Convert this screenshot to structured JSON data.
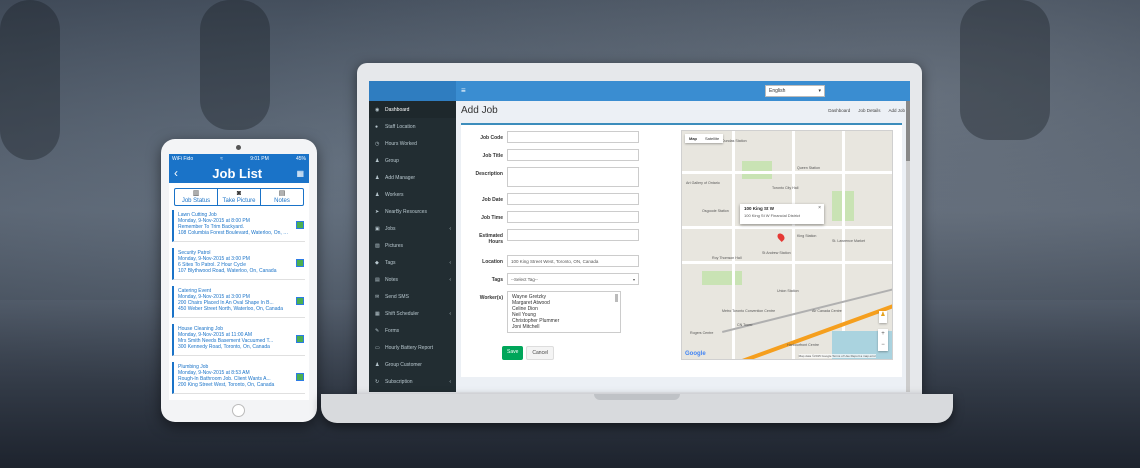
{
  "tablet": {
    "status": {
      "carrier": "WiFi Fido",
      "wifi": "≈",
      "time": "9:01 PM",
      "battery": "45%"
    },
    "title": "Job List",
    "segments": [
      {
        "label": "Job Status",
        "icon": "chart-icon"
      },
      {
        "label": "Take Picture",
        "icon": "camera-icon"
      },
      {
        "label": "Notes",
        "icon": "clipboard-icon"
      }
    ],
    "jobs": [
      {
        "title": "Lawn Cutting Job",
        "date": "Monday, 9-Nov-2015 at 8:00 PM",
        "note": "Remember To Trim Backyard.",
        "address": "108 Columbia Forest Boulevard, Waterloo, On, Canada"
      },
      {
        "title": "Security Patrol",
        "date": "Monday, 9-Nov-2015 at 3:00 PM",
        "note": "6 Sites To Patrol. 2 Hour Cycle",
        "address": "107 Blythwood Road, Waterloo, On, Canada"
      },
      {
        "title": "Catering Event",
        "date": "Monday, 9-Nov-2015 at 3:00 PM",
        "note": "200 Chairs Placed In An Oval Shape In B...",
        "address": "450 Weber Street North, Waterloo, On, Canada"
      },
      {
        "title": "House Cleaning Job",
        "date": "Monday, 9-Nov-2015 at 11:00 AM",
        "note": "Mrs Smith Needs Basement Vacuumed T...",
        "address": "300 Kennedy Road, Toronto, On, Canada"
      },
      {
        "title": "Plumbing Job",
        "date": "Monday, 9-Nov-2015 at 8:53 AM",
        "note": "Rough-In Bathroom Job. Client Wants A...",
        "address": "200 King Street West, Toronto, On, Canada"
      }
    ]
  },
  "app": {
    "menu_icon": "≡",
    "language": "English",
    "page_title": "Add Job",
    "breadcrumbs": [
      "Dashboard",
      "Job Details",
      "Add Job"
    ],
    "sidebar": [
      {
        "label": "Dashboard",
        "icon": "dashboard-icon",
        "glyph": "◉",
        "arrow": ""
      },
      {
        "label": "Staff Location",
        "icon": "location-icon",
        "glyph": "●",
        "arrow": ""
      },
      {
        "label": "Hours Worked",
        "icon": "clock-icon",
        "glyph": "◷",
        "arrow": ""
      },
      {
        "label": "Group",
        "icon": "group-icon",
        "glyph": "♟",
        "arrow": ""
      },
      {
        "label": "Add Manager",
        "icon": "user-plus-icon",
        "glyph": "♟",
        "arrow": ""
      },
      {
        "label": "Workers",
        "icon": "users-icon",
        "glyph": "♟",
        "arrow": ""
      },
      {
        "label": "NearBy Resources",
        "icon": "send-icon",
        "glyph": "➤",
        "arrow": ""
      },
      {
        "label": "Jobs",
        "icon": "briefcase-icon",
        "glyph": "▣",
        "arrow": "‹"
      },
      {
        "label": "Pictures",
        "icon": "picture-icon",
        "glyph": "▨",
        "arrow": ""
      },
      {
        "label": "Tags",
        "icon": "tag-icon",
        "glyph": "◆",
        "arrow": "‹"
      },
      {
        "label": "Notes",
        "icon": "notes-icon",
        "glyph": "▤",
        "arrow": "‹"
      },
      {
        "label": "Send SMS",
        "icon": "envelope-icon",
        "glyph": "✉",
        "arrow": ""
      },
      {
        "label": "Shift Scheduler",
        "icon": "calendar-icon",
        "glyph": "▦",
        "arrow": "‹"
      },
      {
        "label": "Forms",
        "icon": "forms-icon",
        "glyph": "✎",
        "arrow": ""
      },
      {
        "label": "Hourly Battery Report",
        "icon": "battery-icon",
        "glyph": "▭",
        "arrow": ""
      },
      {
        "label": "Group Customer",
        "icon": "customer-icon",
        "glyph": "♟",
        "arrow": ""
      },
      {
        "label": "Subscription",
        "icon": "subscription-icon",
        "glyph": "↻",
        "arrow": "‹"
      }
    ],
    "form": {
      "job_code_label": "Job Code",
      "job_code": "",
      "job_title_label": "Job Title",
      "job_title": "",
      "description_label": "Description",
      "description": "",
      "job_date_label": "Job Date",
      "job_date": "",
      "job_time_label": "Job Time",
      "job_time": "",
      "estimated_hours_label": "Estimated Hours",
      "estimated_hours": "",
      "location_label": "Location",
      "location": "100 King Street West, Toronto, ON, Canada",
      "tags_label": "Tags",
      "tags_placeholder": "--Select Tag--",
      "workers_label": "Worker(s)",
      "workers": [
        "Wayne Gretzky",
        "Margaret Atwood",
        "Celine Dion",
        "Neil Young",
        "Christopher Plummer",
        "Joni Mitchell"
      ],
      "save": "Save",
      "cancel": "Cancel"
    },
    "map": {
      "tab_map": "Map",
      "tab_satellite": "Satellite",
      "popup_title": "100 King St W",
      "popup_address": "100 King St W Financial District",
      "labels": [
        "Dundas Station",
        "Queen Station",
        "Osgoode Station",
        "St Andrew Station",
        "King Station",
        "Union Station",
        "Art Gallery of Ontario",
        "Toronto City Hall",
        "Roy Thomson Hall",
        "Metro Toronto Convention Centre",
        "CN Tower",
        "Rogers Centre",
        "Air Canada Centre",
        "St. Lawrence Market",
        "Harbourfront Centre"
      ],
      "google": "Google",
      "attribution": "Map data ©2015 Google  Terms of Use  Report a map error"
    }
  }
}
